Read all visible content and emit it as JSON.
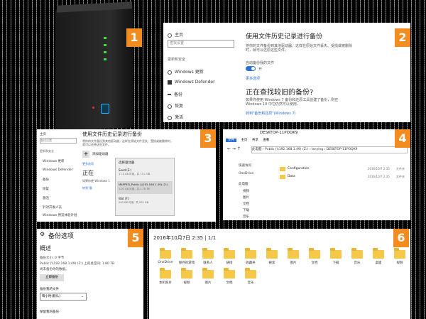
{
  "steps": [
    "1",
    "2",
    "3",
    "4",
    "5",
    "6"
  ],
  "p2": {
    "home": "主页",
    "search_placeholder": "查找设置",
    "cat": "更新和安全",
    "nav": [
      "Windows 更新",
      "Windows Defender",
      "备份",
      "恢复",
      "激活"
    ],
    "title": "使用文件历史记录进行备份",
    "desc": "将你的文件备份到其他驱动器，这样在原始文件丢失、受损或被删除时，就可以还原这些文件。",
    "auto_label": "自动备份我的文件",
    "toggle": "开",
    "more": "更多选项",
    "h2": "正在查找较旧的备份?",
    "desc2": "如果你使用 Windows 7 备份和还原工具创建了备份，则在 Windows 10 中它仍然可以使用。",
    "link": "转到\"备份和还原\"(Windows 7)"
  },
  "p3": {
    "home": "主页",
    "search_placeholder": "查找设置",
    "cat": "更新和安全",
    "nav": [
      "Windows 更新",
      "Windows Defender",
      "备份",
      "恢复",
      "激活",
      "针对开发人员",
      "Windows 预览体验计划"
    ],
    "title": "使用文件历史记录进行备份",
    "desc": "将你的文件备份到其他驱动器，这样在原始文件丢失、受损或被删除时，就可以还原这些文件。",
    "add": "添加驱动器",
    "more": "更多选项",
    "h2": "正在",
    "sub": "如果你使 Windows 1",
    "link": "转到\"备",
    "popup_title": "选择驱动器",
    "drives": [
      {
        "name": "Seed (E:)",
        "info": "17.4 GB 可用，共 73.1 GB"
      },
      {
        "name": "MAPPED_Public (\\\\192.168.1.49) (Z:)",
        "info": "1.03 GB 可用，共 1.76 TB"
      },
      {
        "name": "Wat (F:)",
        "info": "290 GB 可用，共 931 GB"
      }
    ]
  },
  "p4": {
    "title": "DESKTOP-11POQK9",
    "tabs": [
      "文件",
      "主页",
      "共享",
      "查看"
    ],
    "path": [
      "此电脑",
      "Public (\\\\192.168.1.49) (Z:)",
      "lanying",
      "DESKTOP-11POQK9"
    ],
    "nav": [
      "快速访问",
      "OneDrive",
      "此电脑",
      "视频",
      "图片",
      "文档",
      "下载",
      "音乐"
    ],
    "files": [
      {
        "name": "Configuration",
        "date": "2016/10/7 2:35",
        "type": "文件夹"
      },
      {
        "name": "Data",
        "date": "2016/10/7 2:35",
        "type": "文件夹"
      }
    ]
  },
  "p5": {
    "title": "备份选项",
    "overview": "概述",
    "size": "备份大小: 0 字节",
    "space": "Public (\\\\192.168.1.49) (Z:) 上的总空间: 1.80 TB",
    "note": "尚未备份你的数据。",
    "btn": "立即备份",
    "freq_label": "备份我的文件",
    "freq": "每小时(默认)",
    "keep_label": "保留我的备份"
  },
  "p6": {
    "header": "2016年10月7日 2:35  |  1/1",
    "row1": [
      "OneDrive",
      "保存的游戏",
      "联系人",
      "链接",
      "收藏夹",
      "搜索",
      "图片",
      "文档",
      "下载",
      "音乐",
      "桌面",
      "视频"
    ],
    "row2": [
      "本机照片",
      "视频",
      "图片",
      "文档",
      "音乐"
    ],
    "colors": {
      "folder": "#f5c84a",
      "accent": "#f28c1e"
    }
  }
}
